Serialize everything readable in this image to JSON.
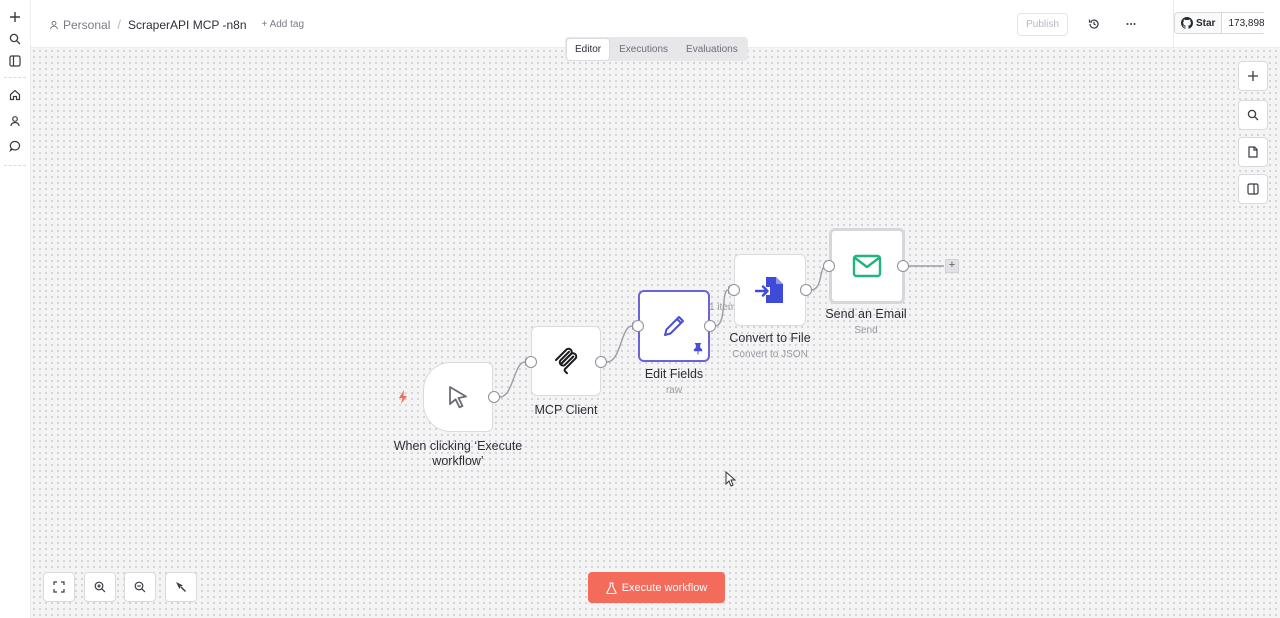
{
  "header": {
    "breadcrumb_personal": "Personal",
    "breadcrumb_separator": "/",
    "workflow_title": "ScraperAPI MCP -n8n",
    "add_tag": "+ Add tag",
    "publish_label": "Publish",
    "github_star_label": "Star",
    "github_star_count": "173,898"
  },
  "tabs": [
    {
      "label": "Editor",
      "active": true
    },
    {
      "label": "Executions",
      "active": false
    },
    {
      "label": "Evaluations",
      "active": false
    }
  ],
  "nodes": {
    "trigger": {
      "label_line1": "When clicking ‘Execute",
      "label_line2": "workflow’",
      "icon": "cursor-icon"
    },
    "mcp_client": {
      "label": "MCP Client",
      "icon": "mcp-icon"
    },
    "edit_fields": {
      "label": "Edit Fields",
      "subtitle": "raw",
      "icon": "pencil-icon",
      "pinned": true
    },
    "convert_to_file": {
      "label": "Convert to File",
      "subtitle": "Convert to JSON",
      "icon": "file-import-icon"
    },
    "send_email": {
      "label": "Send an Email",
      "subtitle": "Send",
      "icon": "mail-icon"
    }
  },
  "connection_items_label": "1 item",
  "execute_button_label": "Execute workflow",
  "colors": {
    "accent_execute": "#f26b5b",
    "selected_node_border": "#6c63d8",
    "email_icon": "#1fb57d",
    "file_icon": "#3e4bd8",
    "pencil_icon": "#4b4fd6",
    "trigger_bolt": "#f26b5b"
  }
}
